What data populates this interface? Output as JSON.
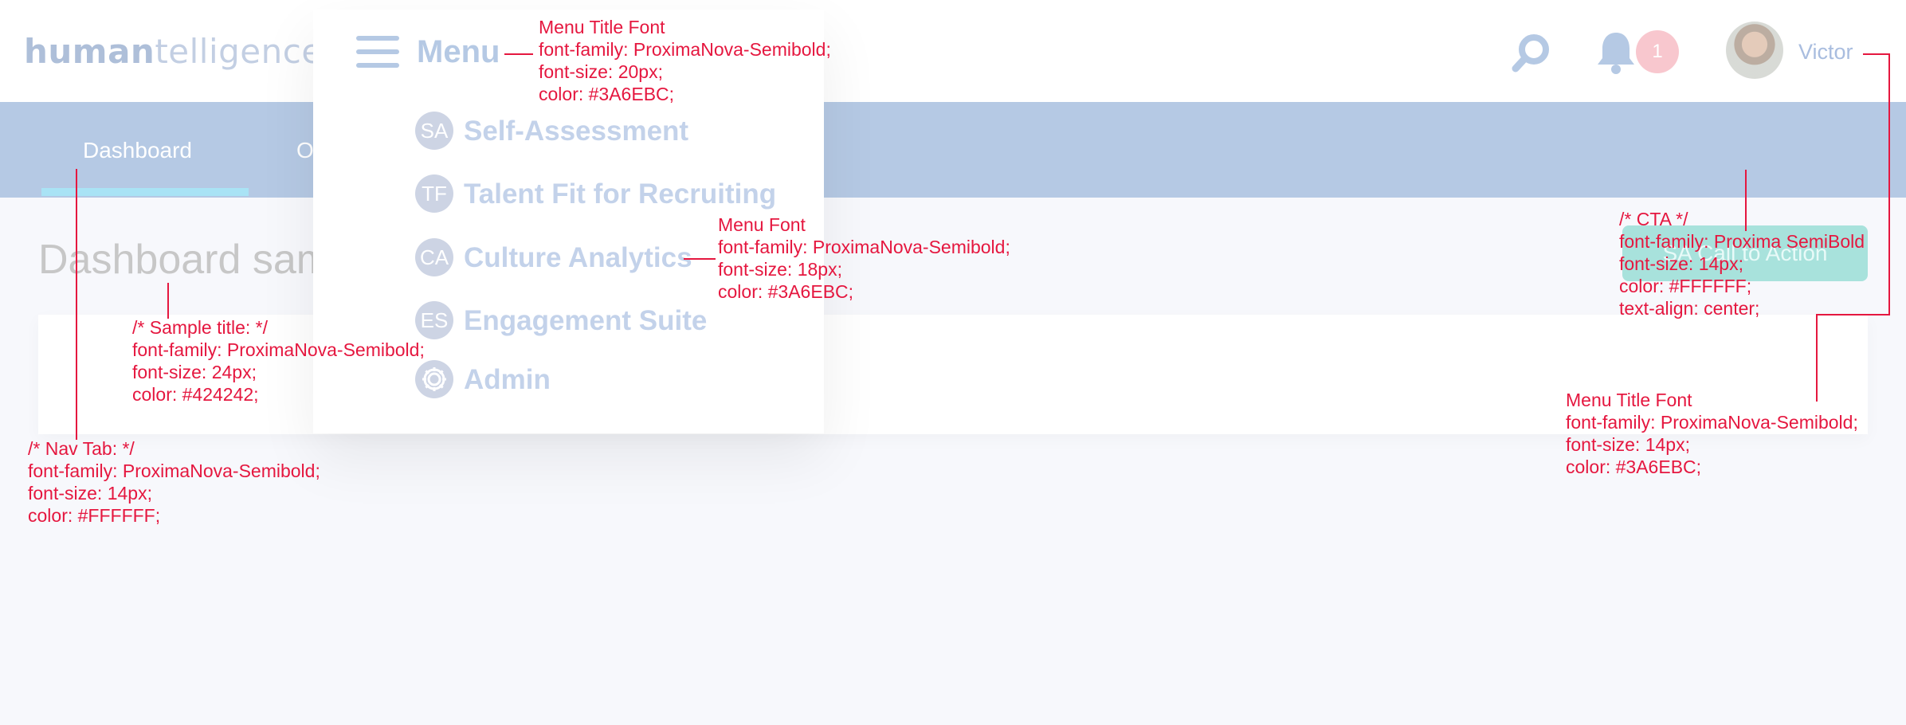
{
  "logo": {
    "part1": "human",
    "part2": "telligence"
  },
  "header": {
    "notification_count": "1",
    "user_name": "Victor"
  },
  "nav": {
    "tabs": [
      {
        "label": "Dashboard"
      },
      {
        "label": "O"
      }
    ],
    "cta_label": "SA Call to Action"
  },
  "page": {
    "title": "Dashboard sam"
  },
  "menu": {
    "title": "Menu",
    "items": [
      {
        "initials": "SA",
        "label": "Self-Assessment"
      },
      {
        "initials": "TF",
        "label": "Talent Fit for Recruiting"
      },
      {
        "initials": "CA",
        "label": "Culture Analytics"
      },
      {
        "initials": "ES",
        "label": "Engagement Suite"
      },
      {
        "initials": "",
        "label": "Admin",
        "icon": "gear-icon"
      }
    ]
  },
  "annotations": {
    "menu_title_font": "Menu Title Font\nfont-family: ProximaNova-Semibold;\nfont-size: 20px;\ncolor: #3A6EBC;",
    "menu_font": "Menu Font\nfont-family: ProximaNova-Semibold;\nfont-size: 18px;\ncolor: #3A6EBC;",
    "sample_title": "/* Sample title: */\nfont-family: ProximaNova-Semibold;\nfont-size: 24px;\ncolor: #424242;",
    "nav_tab": "/* Nav Tab: */\nfont-family: ProximaNova-Semibold;\nfont-size: 14px;\ncolor: #FFFFFF;",
    "cta": "/* CTA */\nfont-family: Proxima SemiBold\nfont-size: 14px;\ncolor: #FFFFFF;\ntext-align: center;",
    "menu_title_font_right": "Menu Title Font\nfont-family: ProximaNova-Semibold;\nfont-size: 14px;\ncolor: #3A6EBC;"
  },
  "colors": {
    "accent": "#3A6EBC",
    "annotation": "#E5173F",
    "nav_bg": "#B5C9E4",
    "cta_bg": "#A8E2DC"
  }
}
